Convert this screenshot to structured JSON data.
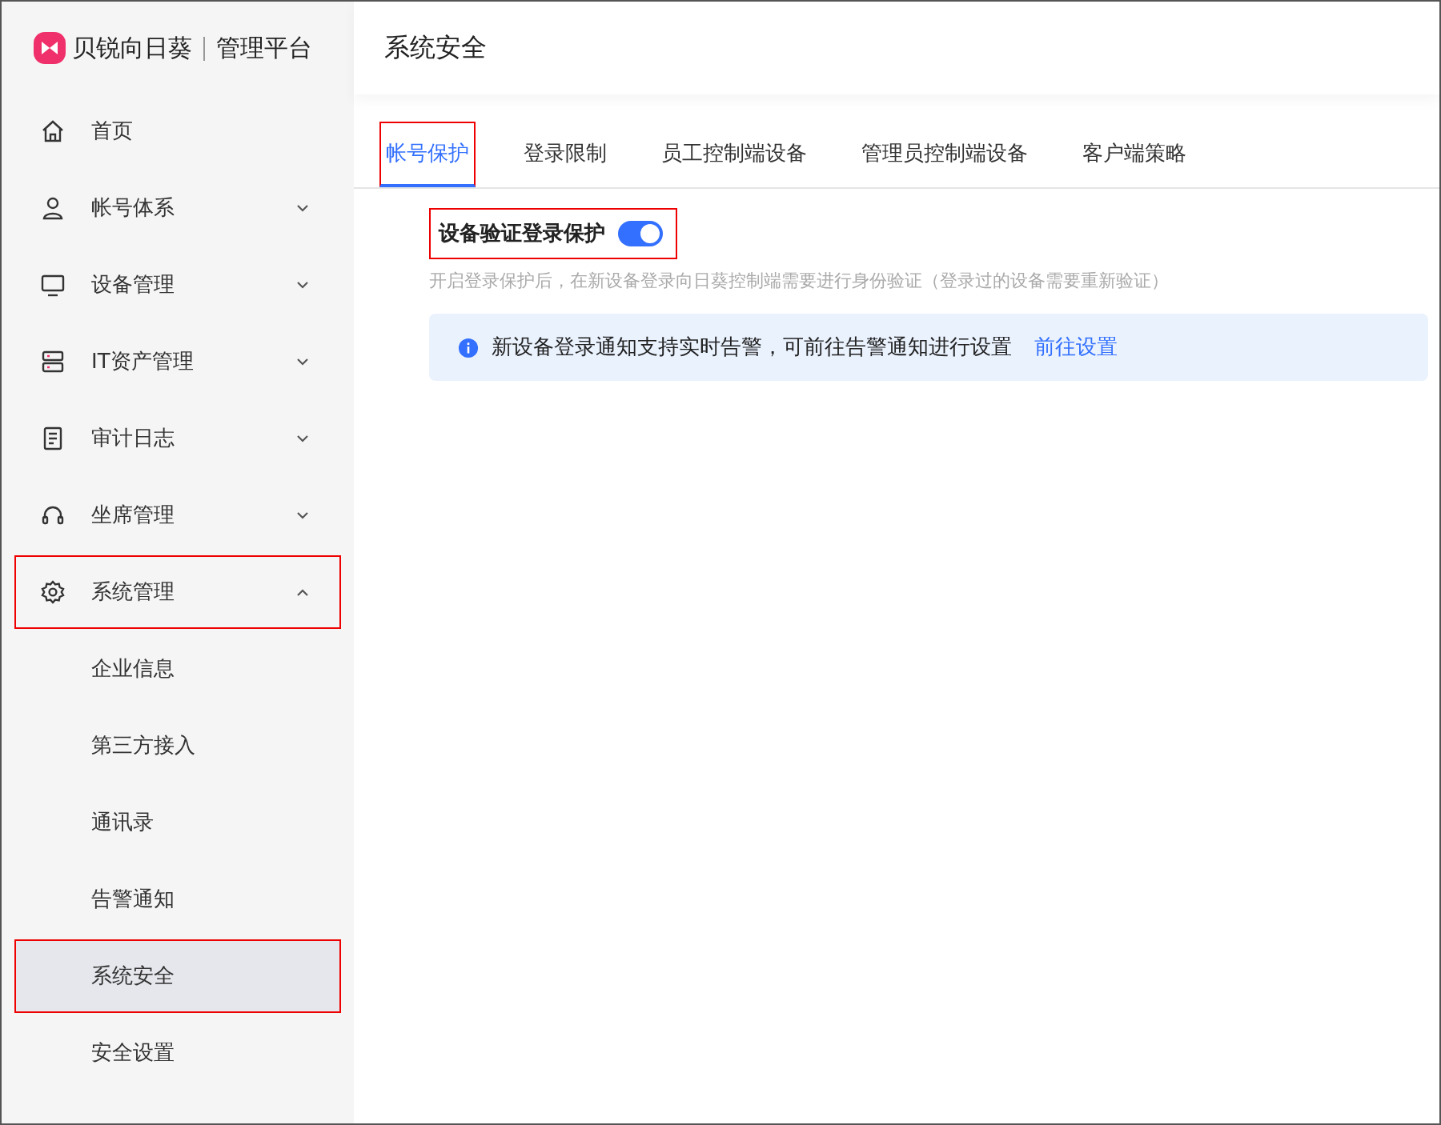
{
  "brand": {
    "name": "贝锐向日葵",
    "product": "管理平台"
  },
  "page_title": "系统安全",
  "sidebar": {
    "items": [
      {
        "label": "首页",
        "selected": false,
        "highlighted": false
      },
      {
        "label": "帐号体系",
        "selected": false,
        "highlighted": false,
        "expanded": false
      },
      {
        "label": "设备管理",
        "selected": false,
        "highlighted": false,
        "expanded": false
      },
      {
        "label": "IT资产管理",
        "selected": false,
        "highlighted": false,
        "expanded": false
      },
      {
        "label": "审计日志",
        "selected": false,
        "highlighted": false,
        "expanded": false
      },
      {
        "label": "坐席管理",
        "selected": false,
        "highlighted": false,
        "expanded": false
      },
      {
        "label": "系统管理",
        "selected": false,
        "highlighted": true,
        "expanded": true,
        "children": [
          {
            "label": "企业信息",
            "selected": false,
            "highlighted": false
          },
          {
            "label": "第三方接入",
            "selected": false,
            "highlighted": false
          },
          {
            "label": "通讯录",
            "selected": false,
            "highlighted": false
          },
          {
            "label": "告警通知",
            "selected": false,
            "highlighted": false
          },
          {
            "label": "系统安全",
            "selected": true,
            "highlighted": true
          },
          {
            "label": "安全设置",
            "selected": false,
            "highlighted": false
          }
        ]
      }
    ]
  },
  "tabs": [
    {
      "label": "帐号保护",
      "selected": true,
      "highlighted": true
    },
    {
      "label": "登录限制",
      "selected": false,
      "highlighted": false
    },
    {
      "label": "员工控制端设备",
      "selected": false,
      "highlighted": false
    },
    {
      "label": "管理员控制端设备",
      "selected": false,
      "highlighted": false
    },
    {
      "label": "客户端策略",
      "selected": false,
      "highlighted": false
    }
  ],
  "setting": {
    "label": "设备验证登录保护",
    "on": true,
    "highlighted": true,
    "description": "开启登录保护后，在新设备登录向日葵控制端需要进行身份验证（登录过的设备需要重新验证）"
  },
  "notice": {
    "text": "新设备登录通知支持实时告警，可前往告警通知进行设置",
    "link": "前往设置"
  }
}
